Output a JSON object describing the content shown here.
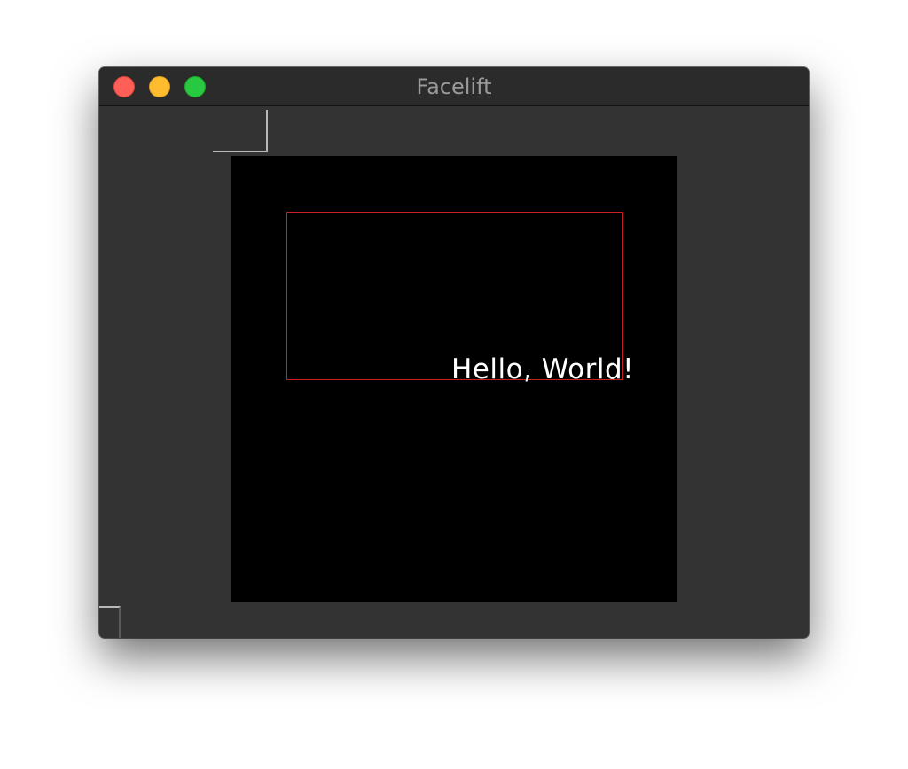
{
  "window": {
    "title": "Facelift",
    "traffic_lights": {
      "close": {
        "color": "#fe5f57",
        "border": "#e0443e"
      },
      "minimize": {
        "color": "#febc2e",
        "border": "#dea123"
      },
      "zoom": {
        "color": "#28c840",
        "border": "#1aab29"
      }
    }
  },
  "canvas": {
    "background": "#000000",
    "text": "Hello, World!",
    "rect_color": "#cc2020"
  }
}
